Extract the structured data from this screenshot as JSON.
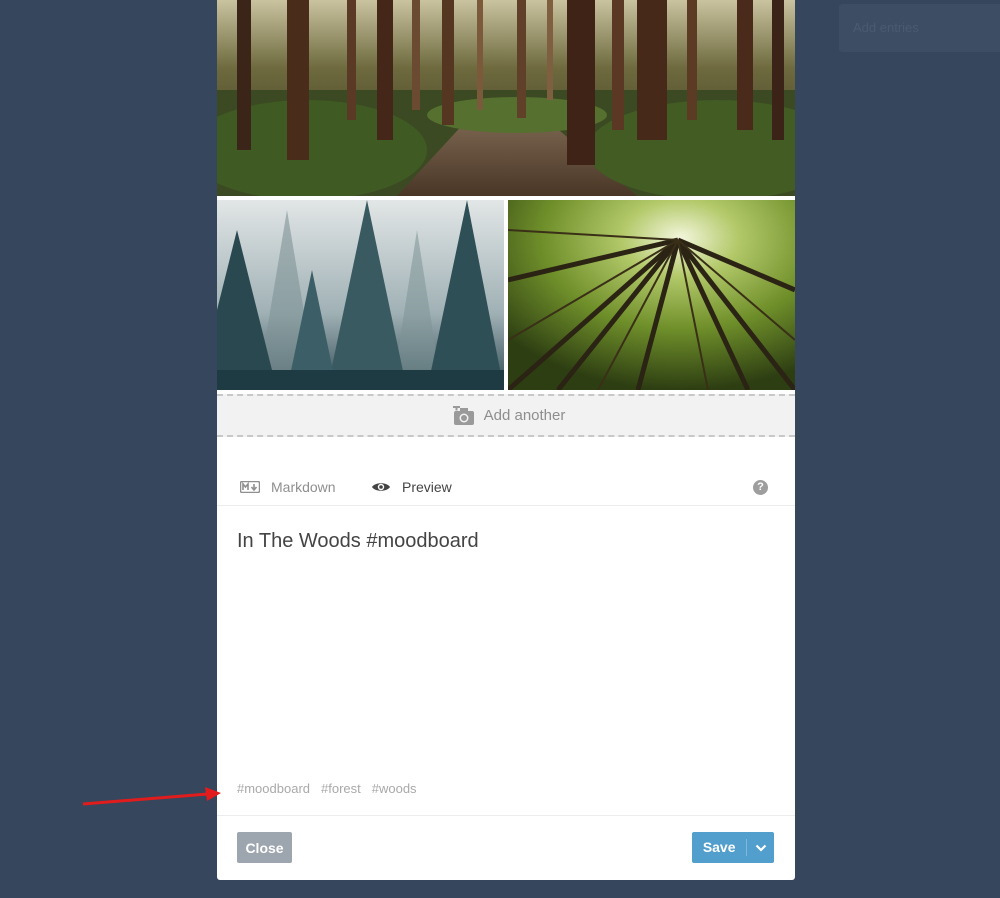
{
  "background_panel": {
    "label": "Add entries"
  },
  "images": [
    {
      "name": "redwood-forest-path",
      "alt": ""
    },
    {
      "name": "misty-pine-forest",
      "alt": ""
    },
    {
      "name": "looking-up-canopy",
      "alt": ""
    }
  ],
  "add_another": {
    "label": "Add another",
    "icon": "camera-plus-icon"
  },
  "editor": {
    "tabs": [
      {
        "label": "Markdown",
        "icon": "markdown-icon"
      },
      {
        "label": "Preview",
        "icon": "eye-icon"
      }
    ],
    "help_label": "?",
    "post_title": "In The Woods #moodboard"
  },
  "tags": [
    "#moodboard",
    "#forest",
    "#woods"
  ],
  "footer": {
    "close_label": "Close",
    "save_label": "Save"
  },
  "colors": {
    "page_background": "#36465d",
    "save_blue": "#529ecc",
    "close_gray": "#9da6af",
    "annotation_red": "#e01c1c"
  }
}
